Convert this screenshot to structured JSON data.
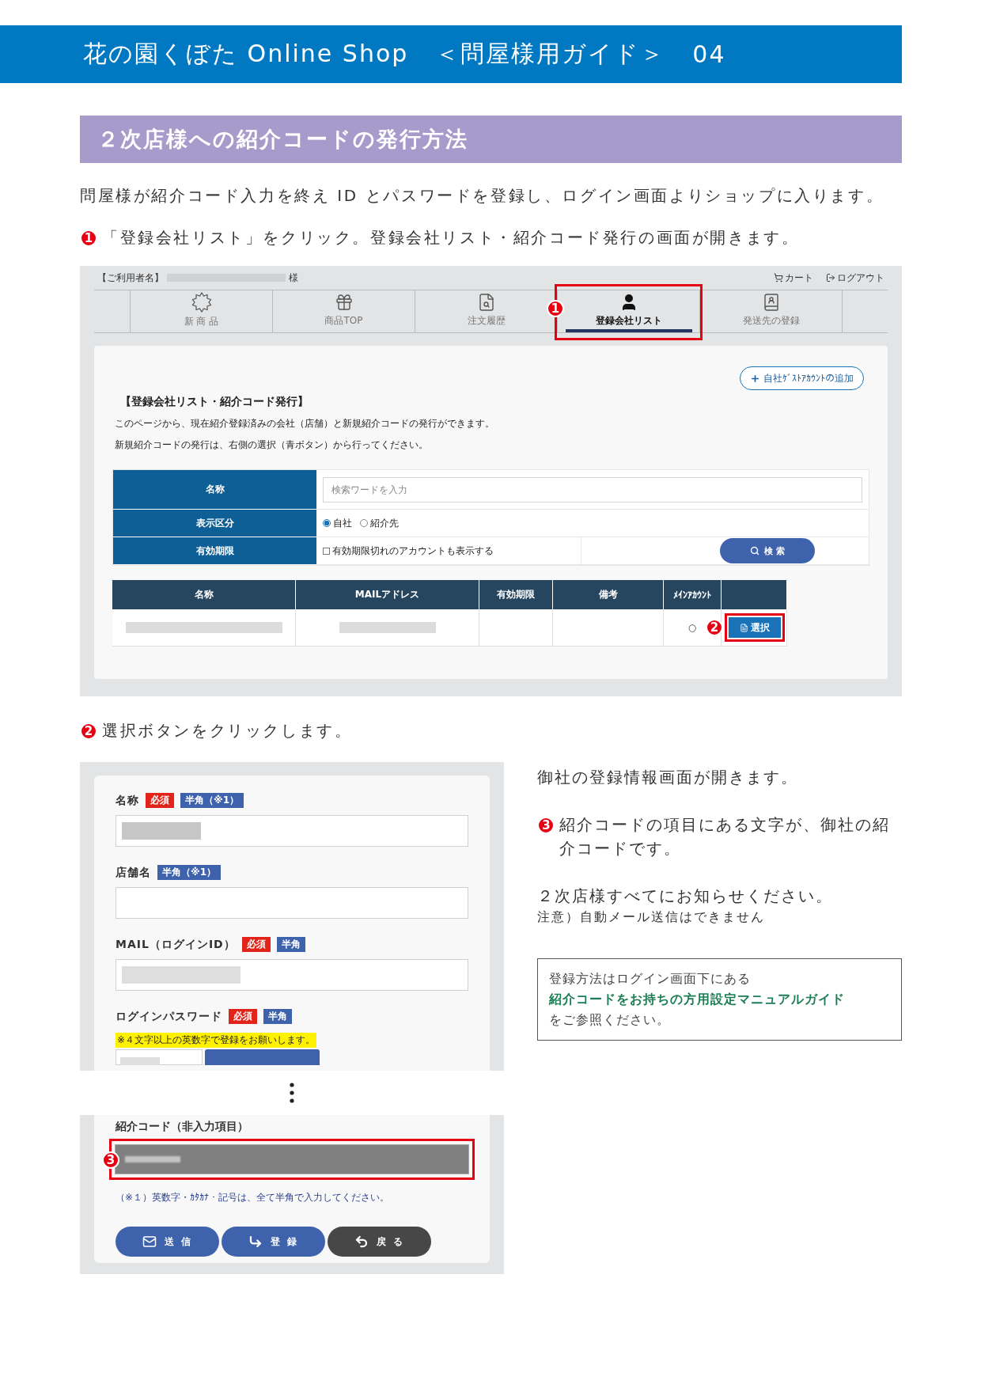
{
  "header": {
    "shop_name": "花の園くぼた Online Shop",
    "guide_label": "＜問屋様用ガイド＞",
    "page_number": "04"
  },
  "section_title": "２次店様への紹介コードの発行方法",
  "intro": "問屋様が紹介コード入力を終え ID とパスワードを登録し、ログイン画面よりショップに入ります。",
  "step_1": {
    "number": "1",
    "text": "「登録会社リスト」をクリック。登録会社リスト・紹介コード発行の画面が開きます。"
  },
  "company_list_screen": {
    "user_label": "【ご利用者名】",
    "user_suffix": "様",
    "cart": "カート",
    "logout": "ログアウト",
    "nav_tabs": [
      {
        "label": "新 商 品",
        "selected": false
      },
      {
        "label": "商品TOP",
        "selected": false
      },
      {
        "label": "注文履歴",
        "selected": false
      },
      {
        "label": "登録会社リスト",
        "selected": true,
        "callout": "1"
      },
      {
        "label": "発送先の登録",
        "selected": false
      }
    ],
    "add_button": "自社ｹﾞｽﾄｱｶｳﾝﾄの追加",
    "title": "【登録会社リスト・紹介コード発行】",
    "description": [
      "このページから、現在紹介登録済みの会社（店舗）と新規紹介コードの発行ができます。",
      "新規紹介コードの発行は、右側の選択（青ボタン）から行ってください。"
    ],
    "search_form": {
      "name_label": "名称",
      "name_placeholder": "検索ワードを入力",
      "type_label": "表示区分",
      "type_options": [
        {
          "label": "自社",
          "selected": true
        },
        {
          "label": "紹介先",
          "selected": false
        }
      ],
      "expiry_label": "有効期限",
      "expiry_checkbox": {
        "label": "有効期限切れのアカウントも表示する",
        "checked": false
      },
      "search_button": "検 索"
    },
    "table": {
      "columns": [
        "名称",
        "MAILアドレス",
        "有効期限",
        "備考",
        "ﾒｲﾝｱｶｳﾝﾄ"
      ],
      "rows": [
        {
          "main_account": "○",
          "select_button": "選択",
          "callout": "2"
        }
      ]
    }
  },
  "step_2": {
    "number": "2",
    "text": "選択ボタンをクリックします。"
  },
  "registration_screen": {
    "fields": [
      {
        "kind": "text",
        "label": "名称",
        "tags": [
          {
            "kind": "required",
            "text": "必須"
          },
          {
            "kind": "half_width",
            "text": "半角（※1）"
          }
        ],
        "redacted": true
      },
      {
        "kind": "text",
        "label": "店舗名",
        "tags": [
          {
            "kind": "half_width",
            "text": "半角（※1）"
          }
        ],
        "redacted": false
      },
      {
        "kind": "text",
        "label": "MAIL（ログインID）",
        "tags": [
          {
            "kind": "required",
            "text": "必須"
          },
          {
            "kind": "half_width",
            "text": "半角"
          }
        ],
        "redacted": true
      },
      {
        "kind": "password",
        "label": "ログインパスワード",
        "tags": [
          {
            "kind": "required",
            "text": "必須"
          },
          {
            "kind": "half_width",
            "text": "半角"
          }
        ],
        "note": "※４文字以上の英数字で登録をお願いします。"
      }
    ],
    "referral_code": {
      "label": "紹介コード（非入力項目）",
      "callout": "3"
    },
    "footnote": "（※１）英数字・ｶﾀｶﾅ・記号は、全て半角で入力してください。",
    "buttons": [
      {
        "kind": "send",
        "label": "送 信"
      },
      {
        "kind": "register",
        "label": "登 録"
      },
      {
        "kind": "back",
        "label": "戻 る"
      }
    ]
  },
  "explanation": {
    "opened": "御社の登録情報画面が開きます。",
    "step_3": {
      "number": "3",
      "text": "紹介コードの項目にある文字が、御社の紹介コードです。"
    },
    "notify": "２次店様すべてにお知らせください。",
    "note": "注意）自動メール送信はできません",
    "info_box": [
      {
        "kind": "plain",
        "text": "登録方法はログイン画面下にある"
      },
      {
        "kind": "guide",
        "text": "紹介コードをお持ちの方用設定マニュアルガイド"
      },
      {
        "kind": "plain",
        "text": "をご参照ください。"
      }
    ]
  }
}
